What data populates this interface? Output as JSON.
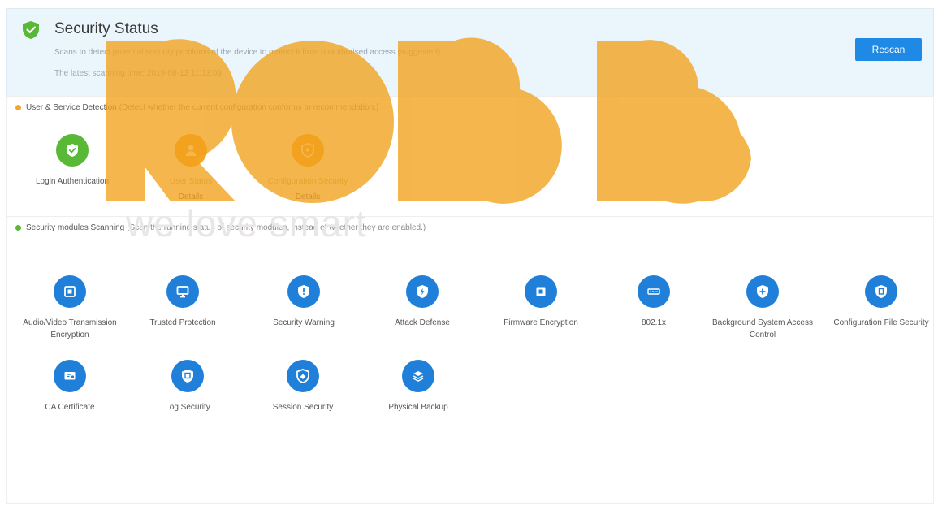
{
  "header": {
    "title": "Security Status",
    "description": "Scans to detect potential security problems of the device to protect it from unauthorised access (suggested)",
    "last_scan": "The latest scanning time: 2019-08-13 11:13:09",
    "rescan_label": "Rescan"
  },
  "user_service": {
    "heading_name": "User & Service Detection",
    "heading_desc": "(Detect whether the current configuration conforms to recommendation.)",
    "items": [
      {
        "label": "Login Authentication",
        "sub": "",
        "color": "green",
        "icon": "shield-check-icon"
      },
      {
        "label": "User Status",
        "sub": "Details",
        "color": "orange",
        "icon": "user-icon"
      },
      {
        "label": "Configuration Security",
        "sub": "Details",
        "color": "orange",
        "icon": "config-shield-icon"
      }
    ]
  },
  "security_modules": {
    "heading_name": "Security modules Scanning",
    "heading_desc": "(Scan the running status of security modules, instead of whether they are enabled.)",
    "items": [
      {
        "label": "Audio/Video Transmission Encryption",
        "icon": "video-encryption-icon"
      },
      {
        "label": "Trusted Protection",
        "icon": "monitor-shield-icon"
      },
      {
        "label": "Security Warning",
        "icon": "warning-shield-icon"
      },
      {
        "label": "Attack Defense",
        "icon": "attack-shield-icon"
      },
      {
        "label": "Firmware Encryption",
        "icon": "firmware-icon"
      },
      {
        "label": "802.1x",
        "icon": "network-8021x-icon"
      },
      {
        "label": "Background System Access Control",
        "icon": "access-shield-icon"
      },
      {
        "label": "Configuration File Security",
        "icon": "file-shield-icon"
      },
      {
        "label": "CA Certificate",
        "icon": "certificate-icon"
      },
      {
        "label": "Log Security",
        "icon": "log-shield-icon"
      },
      {
        "label": "Session Security",
        "icon": "session-shield-icon"
      },
      {
        "label": "Physical Backup",
        "icon": "backup-icon"
      }
    ]
  },
  "watermark": {
    "text": "we love smart"
  },
  "colors": {
    "accent": "#1e8ae6",
    "ok": "#59b836",
    "warn": "#f4a52a",
    "module": "#1f7fd9",
    "header_bg": "#ebf5fc"
  }
}
